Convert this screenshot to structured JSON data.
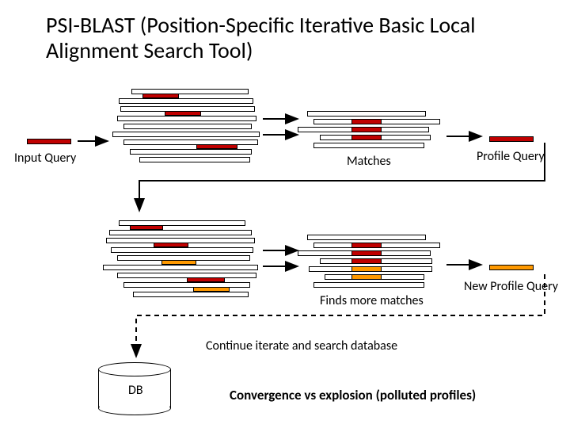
{
  "title": "PSI-BLAST (Position-Specific Iterative Basic Local Alignment Search Tool)",
  "labels": {
    "input_query": "Input Query",
    "matches": "Matches",
    "profile_query": "Profile Query",
    "finds_more": "Finds more matches",
    "new_profile": "New Profile Query",
    "continue": "Continue iterate and search database",
    "db": "DB",
    "convergence": "Convergence vs explosion (polluted profiles)"
  },
  "colors": {
    "red": "#c00000",
    "orange": "#ff9900"
  }
}
